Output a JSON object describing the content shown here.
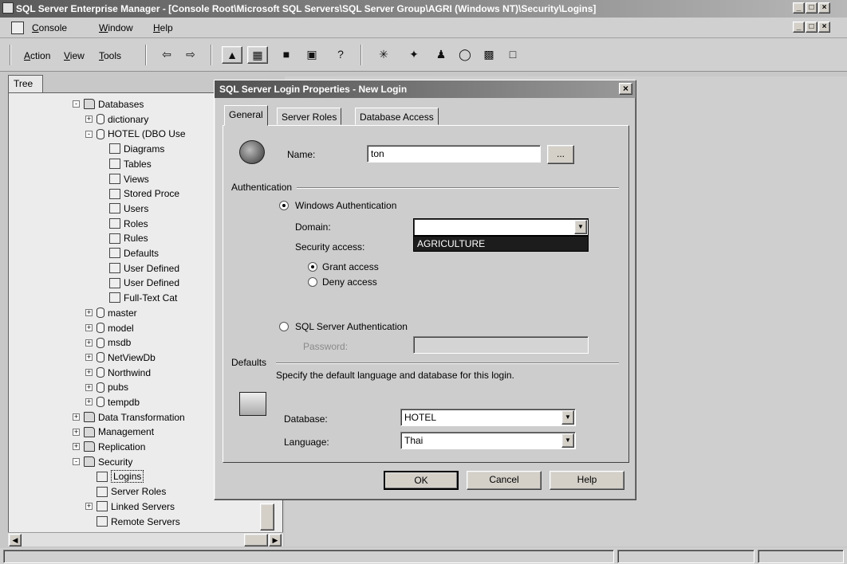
{
  "window": {
    "title": "SQL Server Enterprise Manager - [Console Root\\Microsoft SQL Servers\\SQL Server Group\\AGRI (Windows NT)\\Security\\Logins]",
    "controls": [
      "_",
      "□",
      "×"
    ]
  },
  "menubar": {
    "items": [
      "Console",
      "Window",
      "Help"
    ]
  },
  "toolbar": {
    "action_label": "Action",
    "view_label": "View",
    "tools_label": "Tools"
  },
  "tree": {
    "tab_label": "Tree",
    "rows": [
      {
        "label": "Databases",
        "icon": "folder-icon",
        "expander": "-"
      },
      {
        "label": "dictionary",
        "icon": "database-icon",
        "expander": "+"
      },
      {
        "label": "HOTEL (DBO Use",
        "icon": "database-icon",
        "expander": "-"
      },
      {
        "label": "Diagrams",
        "icon": "diagram-icon",
        "expander": ""
      },
      {
        "label": "Tables",
        "icon": "table-icon",
        "expander": ""
      },
      {
        "label": "Views",
        "icon": "view-icon",
        "expander": ""
      },
      {
        "label": "Stored Proce",
        "icon": "stored-procedure-icon",
        "expander": ""
      },
      {
        "label": "Users",
        "icon": "users-icon",
        "expander": ""
      },
      {
        "label": "Roles",
        "icon": "roles-icon",
        "expander": ""
      },
      {
        "label": "Rules",
        "icon": "rules-icon",
        "expander": ""
      },
      {
        "label": "Defaults",
        "icon": "defaults-icon",
        "expander": ""
      },
      {
        "label": "User Defined",
        "icon": "user-defined-type-icon",
        "expander": ""
      },
      {
        "label": "User Defined",
        "icon": "user-defined-function-icon",
        "expander": ""
      },
      {
        "label": "Full-Text Cat",
        "icon": "full-text-catalog-icon",
        "expander": ""
      },
      {
        "label": "master",
        "icon": "database-icon",
        "expander": "+"
      },
      {
        "label": "model",
        "icon": "database-icon",
        "expander": "+"
      },
      {
        "label": "msdb",
        "icon": "database-icon",
        "expander": "+"
      },
      {
        "label": "NetViewDb",
        "icon": "database-icon",
        "expander": "+"
      },
      {
        "label": "Northwind",
        "icon": "database-icon",
        "expander": "+"
      },
      {
        "label": "pubs",
        "icon": "database-icon",
        "expander": "+"
      },
      {
        "label": "tempdb",
        "icon": "database-icon",
        "expander": "+"
      },
      {
        "label": "Data Transformation",
        "icon": "folder-icon",
        "expander": "+"
      },
      {
        "label": "Management",
        "icon": "folder-icon",
        "expander": "+"
      },
      {
        "label": "Replication",
        "icon": "folder-icon",
        "expander": "+"
      },
      {
        "label": "Security",
        "icon": "folder-icon",
        "expander": "-"
      },
      {
        "label": "Logins",
        "icon": "logins-icon",
        "expander": "",
        "selected": true
      },
      {
        "label": "Server Roles",
        "icon": "server-roles-icon",
        "expander": ""
      },
      {
        "label": "Linked Servers",
        "icon": "linked-servers-icon",
        "expander": "+"
      },
      {
        "label": "Remote Servers",
        "icon": "remote-servers-icon",
        "expander": ""
      }
    ]
  },
  "dialog": {
    "title": "SQL Server Login Properties - New Login",
    "tabs": [
      "General",
      "Server Roles",
      "Database Access"
    ],
    "name_label": "Name:",
    "name_value": "ton",
    "browse_label": "...",
    "authentication_label": "Authentication",
    "windows_auth_label": "Windows Authentication",
    "domain_label": "Domain:",
    "domain_value": "",
    "domain_dropdown_option": "AGRICULTURE",
    "security_access_label": "Security access:",
    "grant_access_label": "Grant access",
    "deny_access_label": "Deny access",
    "sql_auth_label": "SQL Server Authentication",
    "password_label": "Password:",
    "defaults_label": "Defaults",
    "defaults_desc": "Specify the default language and database for this login.",
    "database_label": "Database:",
    "database_value": "HOTEL",
    "language_label": "Language:",
    "language_value": "Thai",
    "ok_label": "OK",
    "cancel_label": "Cancel",
    "help_label": "Help"
  }
}
